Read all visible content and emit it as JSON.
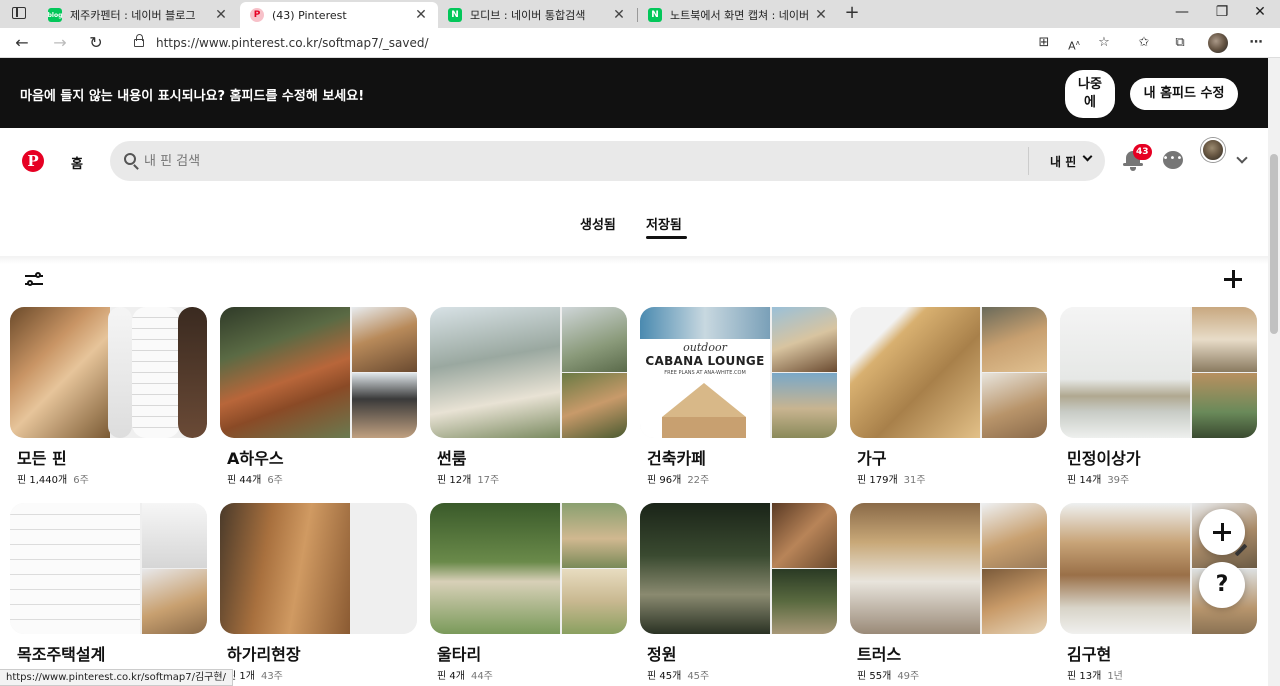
{
  "browser": {
    "tabs": [
      {
        "title": "제주카펜터 : 네이버 블로그",
        "favicon": "blog",
        "favicon_color": "#03c75a"
      },
      {
        "title": "(43) Pinterest",
        "favicon": "P",
        "favicon_color": "#e60023"
      },
      {
        "title": "모디브 : 네이버 통합검색",
        "favicon": "N",
        "favicon_color": "#03c75a"
      },
      {
        "title": "노트북에서 화면 캡쳐 : 네이버 ...",
        "favicon": "N",
        "favicon_color": "#03c75a"
      }
    ],
    "address": "https://www.pinterest.co.kr/softmap7/_saved/"
  },
  "banner": {
    "message": "마음에 들지 않는 내용이 표시되나요? 홈피드를 수정해 보세요!",
    "later_label": "나중\n에",
    "edit_label": "내 홈피드 수정"
  },
  "header": {
    "logo": "P",
    "home_label": "홈",
    "search_placeholder": "내 핀 검색",
    "scope_label": "내 핀",
    "notification_count": "43"
  },
  "profile_tabs": {
    "created": "생성됨",
    "saved": "저장됨",
    "active": "saved"
  },
  "boards": [
    {
      "title": "모든 핀",
      "pins": "핀 1,440개",
      "age": "6주"
    },
    {
      "title": "A하우스",
      "pins": "핀 44개",
      "age": "6주"
    },
    {
      "title": "썬룸",
      "pins": "핀 12개",
      "age": "17주"
    },
    {
      "title": "건축카페",
      "pins": "핀 96개",
      "age": "22주",
      "cover_text": "outdoor",
      "cover_headline": "CABANA LOUNGE",
      "cover_sub": "FREE PLANS AT ANA-WHITE.COM"
    },
    {
      "title": "가구",
      "pins": "핀 179개",
      "age": "31주"
    },
    {
      "title": "민정이상가",
      "pins": "핀 14개",
      "age": "39주"
    },
    {
      "title": "목조주택설계",
      "pins": "",
      "age": ""
    },
    {
      "title": "하가리현장",
      "pins": "핀 1개",
      "age": "43주"
    },
    {
      "title": "울타리",
      "pins": "핀 4개",
      "age": "44주"
    },
    {
      "title": "정원",
      "pins": "핀 45개",
      "age": "45주"
    },
    {
      "title": "트러스",
      "pins": "핀 55개",
      "age": "49주"
    },
    {
      "title": "김구현",
      "pins": "핀 13개",
      "age": "1년"
    }
  ],
  "floating": {
    "help_label": "?"
  },
  "status_bar_url": "https://www.pinterest.co.kr/softmap7/김구현/"
}
